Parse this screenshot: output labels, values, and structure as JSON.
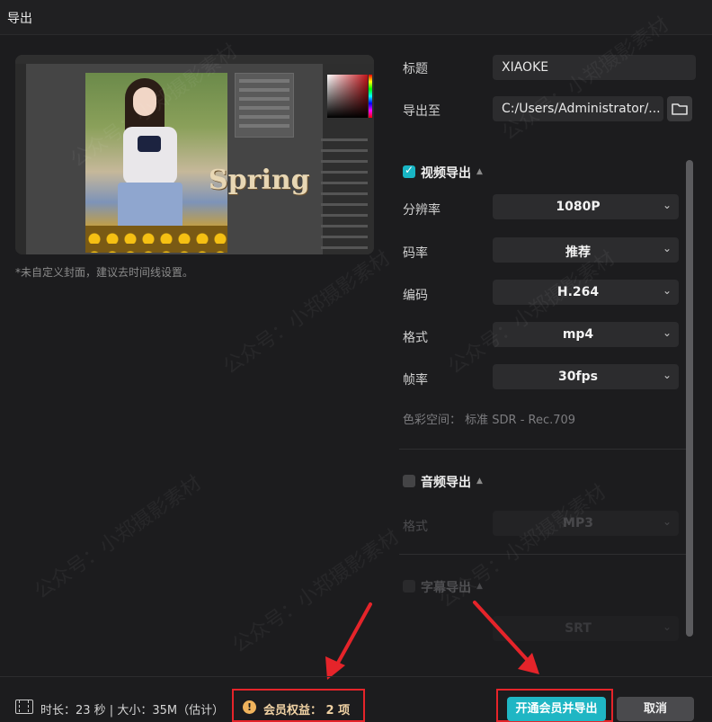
{
  "window": {
    "title": "导出"
  },
  "preview": {
    "overlay_text": "Spring",
    "note": "*未自定义封面，建议去时间线设置。"
  },
  "form": {
    "title_label": "标题",
    "title_value": "XIAOKE",
    "export_to_label": "导出至",
    "export_to_value": "C:/Users/Administrator/...",
    "folder_icon": "folder-icon"
  },
  "video_section": {
    "title": "视频导出",
    "checked": true,
    "rows": [
      {
        "label": "分辨率",
        "value": "1080P"
      },
      {
        "label": "码率",
        "value": "推荐"
      },
      {
        "label": "编码",
        "value": "H.264"
      },
      {
        "label": "格式",
        "value": "mp4"
      },
      {
        "label": "帧率",
        "value": "30fps"
      }
    ],
    "color_space": "色彩空间： 标准 SDR - Rec.709"
  },
  "audio_section": {
    "title": "音频导出",
    "checked": false,
    "format_label": "格式",
    "format_value": "MP3"
  },
  "subtitle_section": {
    "title": "字幕导出",
    "checked": false,
    "format_value": "SRT"
  },
  "footer": {
    "duration_size": "时长：23 秒 | 大小：35M（估计）",
    "member_benefit": "会员权益： 2 项",
    "primary_button": "开通会员并导出",
    "cancel_button": "取消"
  },
  "colors": {
    "accent": "#1fb6c4",
    "annotation_red": "#e5242a",
    "background": "#1c1c1e"
  },
  "watermark": "公众号：小郑摄影素材"
}
